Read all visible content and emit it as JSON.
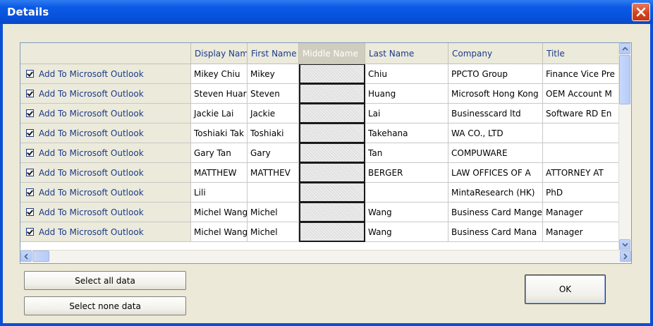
{
  "window": {
    "title": "Details",
    "colors": {
      "title_bar": "#0a4fd8",
      "close_button": "#d2401e",
      "dialog_face": "#ece9d8",
      "grid_border": "#7f9db9"
    }
  },
  "grid": {
    "columns": [
      {
        "key": "action",
        "label": ""
      },
      {
        "key": "display_name",
        "label": "Display Nam"
      },
      {
        "key": "first_name",
        "label": "First Name"
      },
      {
        "key": "middle_name",
        "label": "Middle Name"
      },
      {
        "key": "last_name",
        "label": "Last Name"
      },
      {
        "key": "company",
        "label": "Company"
      },
      {
        "key": "title",
        "label": "Title"
      }
    ],
    "rows": [
      {
        "action": "Add To Microsoft Outlook",
        "display_name": "Mikey Chiu",
        "first_name": "Mikey",
        "middle_name": "",
        "last_name": "Chiu",
        "company": "PPCTO Group",
        "title": "Finance Vice Pre"
      },
      {
        "action": "Add To Microsoft Outlook",
        "display_name": "Steven Huar",
        "first_name": "Steven",
        "middle_name": "",
        "last_name": "Huang",
        "company": "Microsoft Hong Kong",
        "title": "OEM Account M"
      },
      {
        "action": "Add To Microsoft Outlook",
        "display_name": "Jackie Lai",
        "first_name": "Jackie",
        "middle_name": "",
        "last_name": "Lai",
        "company": "Businesscard ltd",
        "title": "Software RD En"
      },
      {
        "action": "Add To Microsoft Outlook",
        "display_name": "Toshiaki Tak",
        "first_name": "Toshiaki",
        "middle_name": "",
        "last_name": "Takehana",
        "company": "WA CO., LTD",
        "title": ""
      },
      {
        "action": "Add To Microsoft Outlook",
        "display_name": "Gary Tan",
        "first_name": "Gary",
        "middle_name": "",
        "last_name": "Tan",
        "company": "COMPUWARE",
        "title": ""
      },
      {
        "action": "Add To Microsoft Outlook",
        "display_name": "MATTHEW",
        "first_name": "MATTHEV",
        "middle_name": "",
        "last_name": "BERGER",
        "company": "LAW OFFICES OF A",
        "title": "ATTORNEY AT"
      },
      {
        "action": "Add To Microsoft Outlook",
        "display_name": "Lili",
        "first_name": "",
        "middle_name": "",
        "last_name": "",
        "company": "MintaResearch (HK)",
        "title": "PhD"
      },
      {
        "action": "Add To Microsoft Outlook",
        "display_name": "Michel Wang",
        "first_name": "Michel",
        "middle_name": "",
        "last_name": "Wang",
        "company": "Business Card Mange",
        "title": "Manager"
      },
      {
        "action": "Add To Microsoft Outlook",
        "display_name": "Michel Wang",
        "first_name": "Michel",
        "middle_name": "",
        "last_name": "Wang",
        "company": "Business Card Mana",
        "title": "Manager"
      }
    ]
  },
  "buttons": {
    "select_all": "Select all data",
    "select_none": "Select none data",
    "ok": "OK"
  }
}
